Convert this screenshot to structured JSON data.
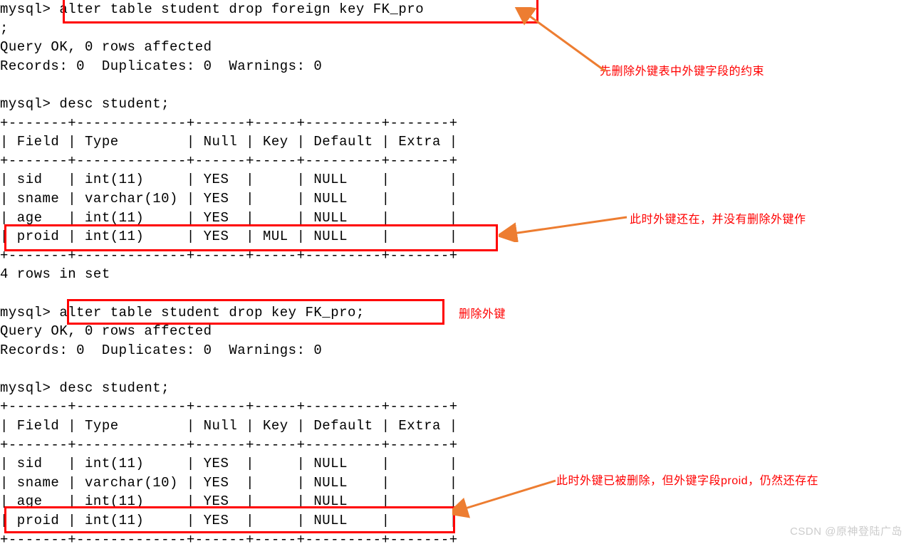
{
  "prompt": "mysql>",
  "cmd1": "alter table student drop foreign key FK_pro",
  "semicolon": ";",
  "query_ok": "Query OK, 0 rows affected",
  "records": "Records: 0  Duplicates: 0  Warnings: 0",
  "cmd_desc": "desc student;",
  "table_sep": "+-------+-------------+------+-----+---------+-------+",
  "table_header": "| Field | Type        | Null | Key | Default | Extra |",
  "t1_row1": "| sid   | int(11)     | YES  |     | NULL    |       |",
  "t1_row2": "| sname | varchar(10) | YES  |     | NULL    |       |",
  "t1_row3": "| age   | int(11)     | YES  |     | NULL    |       |",
  "t1_row4": "| proid | int(11)     | YES  | MUL | NULL    |       |",
  "rows_in_set": "4 rows in set",
  "cmd2": "alter table student drop key FK_pro;",
  "t2_row4": "| proid | int(11)     | YES  |     | NULL    |       |",
  "ann1": "先删除外键表中外键字段的约束",
  "ann2": "此时外键还在，并没有删除外键作",
  "ann3": "删除外键",
  "ann4": "此时外键已被删除，但外键字段proid，仍然还存在",
  "watermark": "CSDN @原神登陆广岛"
}
